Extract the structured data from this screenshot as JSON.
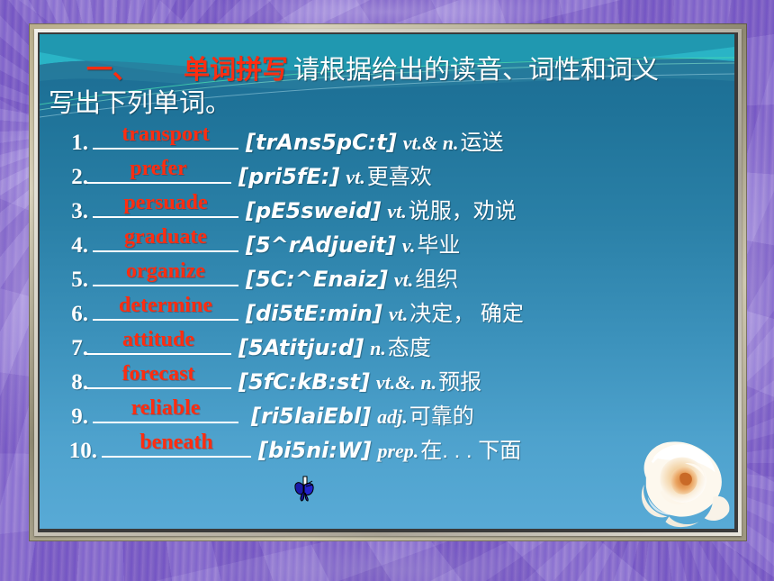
{
  "slide": {
    "heading_marker": "一、",
    "heading_title": "单词拼写",
    "heading_rest": "请根据给出的读音、词性和词义",
    "heading_line2": "写出下列单词。",
    "colors": {
      "answer_red": "#ff2d10",
      "text_white": "#ffffff",
      "background_top": "#1b6c92",
      "background_bottom": "#58aad6",
      "wave_teal": "#2bb3c4",
      "frame_purple": "#8b76d2"
    },
    "items": [
      {
        "num": "1.",
        "answer": "transport",
        "phonetic": "[trAns5pC:t]",
        "pos": "vt.& n.",
        "meaning": "运送"
      },
      {
        "num": "2.",
        "answer": "prefer",
        "phonetic": "[pri5fE:]",
        "pos": "vt.",
        "meaning": "更喜欢"
      },
      {
        "num": "3.",
        "answer": "persuade",
        "phonetic": "[pE5sweid]",
        "pos": "vt.",
        "meaning": "说服，劝说"
      },
      {
        "num": "4.",
        "answer": "graduate",
        "phonetic": "[5^rAdjueit]",
        "pos": "v.",
        "meaning": "毕业"
      },
      {
        "num": "5.",
        "answer": "organize",
        "phonetic": "[5C:^Enaiz]",
        "pos": "vt.",
        "meaning": "组织"
      },
      {
        "num": "6.",
        "answer": "determine",
        "phonetic": "[di5tE:min]",
        "pos": "vt.",
        "meaning": "决定， 确定"
      },
      {
        "num": "7.",
        "answer": "attitude",
        "phonetic": "[5Atitju:d]",
        "pos": "n.",
        "meaning": "态度"
      },
      {
        "num": "8.",
        "answer": "forecast",
        "phonetic": "[5fC:kB:st]",
        "pos": "vt.&. n.",
        "meaning": "预报"
      },
      {
        "num": "9.",
        "answer": "reliable",
        "phonetic": "[ri5laiEbl]",
        "pos": "adj.",
        "meaning": "可靠的"
      },
      {
        "num": "10.",
        "answer": "beneath",
        "phonetic": "[bi5ni:W]",
        "pos": "prep.",
        "meaning": "在. . . 下面"
      }
    ]
  },
  "decor": {
    "rose_label": "white-rose",
    "butterfly_label": "butterfly-cursor"
  }
}
